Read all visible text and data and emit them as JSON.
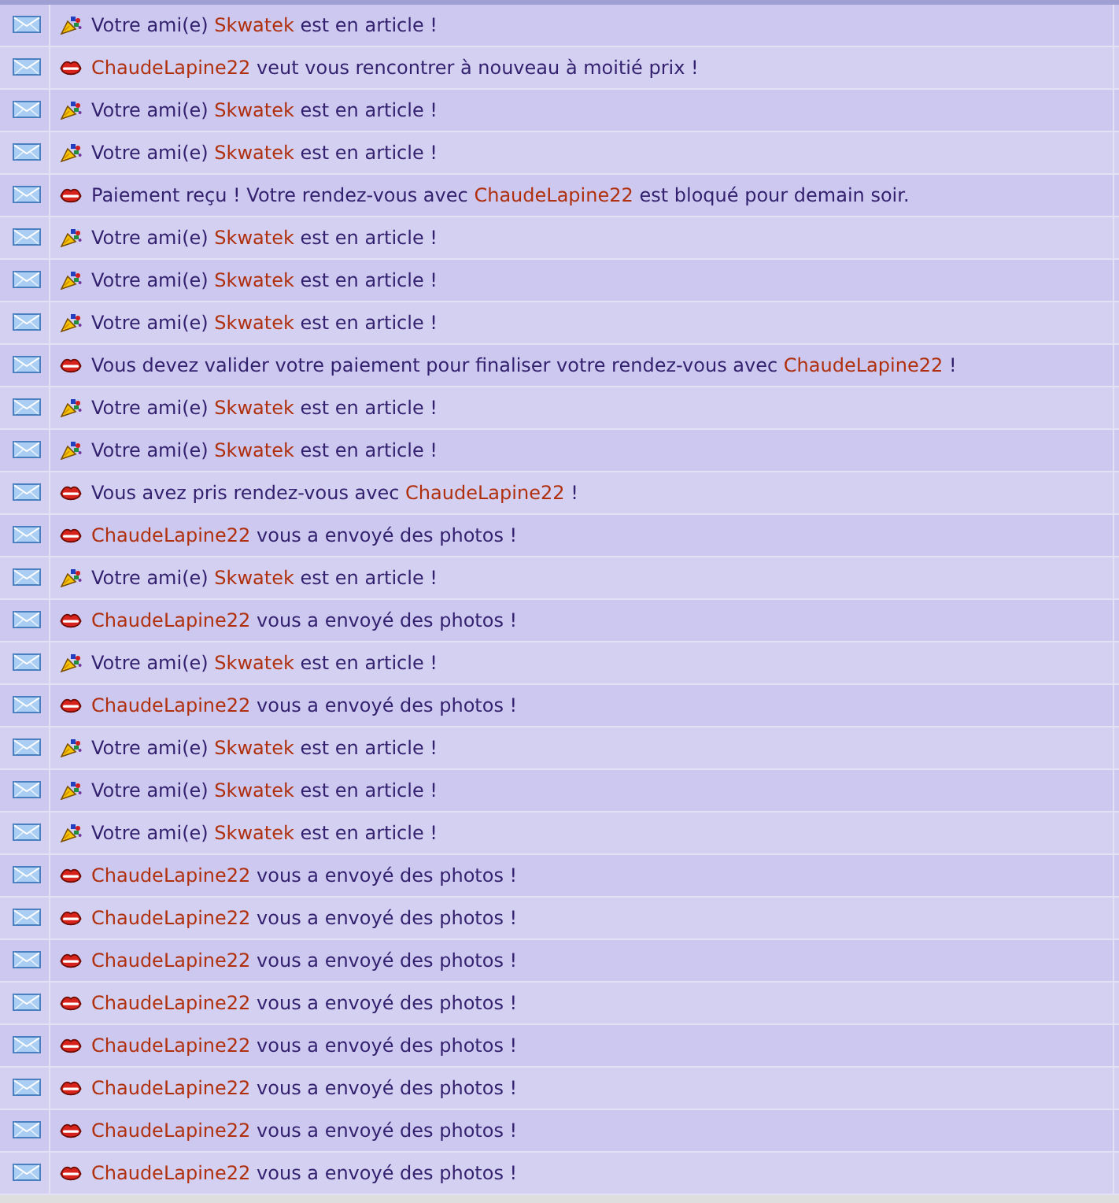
{
  "notifications": [
    {
      "kind": "party",
      "parts": [
        {
          "kind": "text",
          "text": "Votre ami(e)"
        },
        {
          "kind": "user",
          "text": "Skwatek"
        },
        {
          "kind": "text",
          "text": "est en article !"
        }
      ]
    },
    {
      "kind": "kiss",
      "parts": [
        {
          "kind": "user",
          "text": "ChaudeLapine22"
        },
        {
          "kind": "text",
          "text": "veut vous rencontrer à nouveau à moitié prix !"
        }
      ]
    },
    {
      "kind": "party",
      "parts": [
        {
          "kind": "text",
          "text": "Votre ami(e)"
        },
        {
          "kind": "user",
          "text": "Skwatek"
        },
        {
          "kind": "text",
          "text": "est en article !"
        }
      ]
    },
    {
      "kind": "party",
      "parts": [
        {
          "kind": "text",
          "text": "Votre ami(e)"
        },
        {
          "kind": "user",
          "text": "Skwatek"
        },
        {
          "kind": "text",
          "text": "est en article !"
        }
      ]
    },
    {
      "kind": "kiss",
      "parts": [
        {
          "kind": "text",
          "text": "Paiement reçu ! Votre rendez-vous avec"
        },
        {
          "kind": "user",
          "text": "ChaudeLapine22"
        },
        {
          "kind": "text",
          "text": "est bloqué pour demain soir."
        }
      ]
    },
    {
      "kind": "party",
      "parts": [
        {
          "kind": "text",
          "text": "Votre ami(e)"
        },
        {
          "kind": "user",
          "text": "Skwatek"
        },
        {
          "kind": "text",
          "text": "est en article !"
        }
      ]
    },
    {
      "kind": "party",
      "parts": [
        {
          "kind": "text",
          "text": "Votre ami(e)"
        },
        {
          "kind": "user",
          "text": "Skwatek"
        },
        {
          "kind": "text",
          "text": "est en article !"
        }
      ]
    },
    {
      "kind": "party",
      "parts": [
        {
          "kind": "text",
          "text": "Votre ami(e)"
        },
        {
          "kind": "user",
          "text": "Skwatek"
        },
        {
          "kind": "text",
          "text": "est en article !"
        }
      ]
    },
    {
      "kind": "kiss",
      "parts": [
        {
          "kind": "text",
          "text": "Vous devez valider votre paiement pour finaliser votre rendez-vous avec"
        },
        {
          "kind": "user",
          "text": "ChaudeLapine22"
        },
        {
          "kind": "text",
          "text": "!"
        }
      ]
    },
    {
      "kind": "party",
      "parts": [
        {
          "kind": "text",
          "text": "Votre ami(e)"
        },
        {
          "kind": "user",
          "text": "Skwatek"
        },
        {
          "kind": "text",
          "text": "est en article !"
        }
      ]
    },
    {
      "kind": "party",
      "parts": [
        {
          "kind": "text",
          "text": "Votre ami(e)"
        },
        {
          "kind": "user",
          "text": "Skwatek"
        },
        {
          "kind": "text",
          "text": "est en article !"
        }
      ]
    },
    {
      "kind": "kiss",
      "parts": [
        {
          "kind": "text",
          "text": "Vous avez pris rendez-vous avec"
        },
        {
          "kind": "user",
          "text": "ChaudeLapine22"
        },
        {
          "kind": "text",
          "text": "!"
        }
      ]
    },
    {
      "kind": "kiss",
      "parts": [
        {
          "kind": "user",
          "text": "ChaudeLapine22"
        },
        {
          "kind": "text",
          "text": "vous a envoyé des photos !"
        }
      ]
    },
    {
      "kind": "party",
      "parts": [
        {
          "kind": "text",
          "text": "Votre ami(e)"
        },
        {
          "kind": "user",
          "text": "Skwatek"
        },
        {
          "kind": "text",
          "text": "est en article !"
        }
      ]
    },
    {
      "kind": "kiss",
      "parts": [
        {
          "kind": "user",
          "text": "ChaudeLapine22"
        },
        {
          "kind": "text",
          "text": "vous a envoyé des photos !"
        }
      ]
    },
    {
      "kind": "party",
      "parts": [
        {
          "kind": "text",
          "text": "Votre ami(e)"
        },
        {
          "kind": "user",
          "text": "Skwatek"
        },
        {
          "kind": "text",
          "text": "est en article !"
        }
      ]
    },
    {
      "kind": "kiss",
      "parts": [
        {
          "kind": "user",
          "text": "ChaudeLapine22"
        },
        {
          "kind": "text",
          "text": "vous a envoyé des photos !"
        }
      ]
    },
    {
      "kind": "party",
      "parts": [
        {
          "kind": "text",
          "text": "Votre ami(e)"
        },
        {
          "kind": "user",
          "text": "Skwatek"
        },
        {
          "kind": "text",
          "text": "est en article !"
        }
      ]
    },
    {
      "kind": "party",
      "parts": [
        {
          "kind": "text",
          "text": "Votre ami(e)"
        },
        {
          "kind": "user",
          "text": "Skwatek"
        },
        {
          "kind": "text",
          "text": "est en article !"
        }
      ]
    },
    {
      "kind": "party",
      "parts": [
        {
          "kind": "text",
          "text": "Votre ami(e)"
        },
        {
          "kind": "user",
          "text": "Skwatek"
        },
        {
          "kind": "text",
          "text": "est en article !"
        }
      ]
    },
    {
      "kind": "kiss",
      "parts": [
        {
          "kind": "user",
          "text": "ChaudeLapine22"
        },
        {
          "kind": "text",
          "text": "vous a envoyé des photos !"
        }
      ]
    },
    {
      "kind": "kiss",
      "parts": [
        {
          "kind": "user",
          "text": "ChaudeLapine22"
        },
        {
          "kind": "text",
          "text": "vous a envoyé des photos !"
        }
      ]
    },
    {
      "kind": "kiss",
      "parts": [
        {
          "kind": "user",
          "text": "ChaudeLapine22"
        },
        {
          "kind": "text",
          "text": "vous a envoyé des photos !"
        }
      ]
    },
    {
      "kind": "kiss",
      "parts": [
        {
          "kind": "user",
          "text": "ChaudeLapine22"
        },
        {
          "kind": "text",
          "text": "vous a envoyé des photos !"
        }
      ]
    },
    {
      "kind": "kiss",
      "parts": [
        {
          "kind": "user",
          "text": "ChaudeLapine22"
        },
        {
          "kind": "text",
          "text": "vous a envoyé des photos !"
        }
      ]
    },
    {
      "kind": "kiss",
      "parts": [
        {
          "kind": "user",
          "text": "ChaudeLapine22"
        },
        {
          "kind": "text",
          "text": "vous a envoyé des photos !"
        }
      ]
    },
    {
      "kind": "kiss",
      "parts": [
        {
          "kind": "user",
          "text": "ChaudeLapine22"
        },
        {
          "kind": "text",
          "text": "vous a envoyé des photos !"
        }
      ]
    },
    {
      "kind": "kiss",
      "parts": [
        {
          "kind": "user",
          "text": "ChaudeLapine22"
        },
        {
          "kind": "text",
          "text": "vous a envoyé des photos !"
        }
      ]
    }
  ]
}
